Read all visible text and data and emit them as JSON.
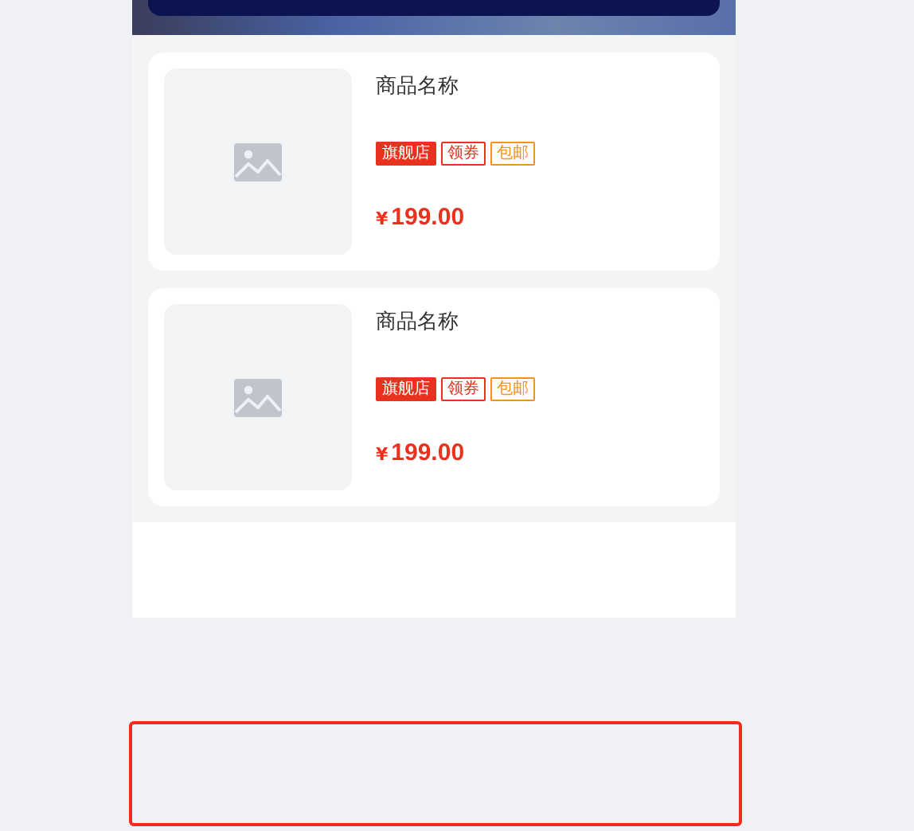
{
  "products": [
    {
      "title": "商品名称",
      "tags": [
        {
          "label": "旗舰店",
          "kind": "solid",
          "color": "#e8321f"
        },
        {
          "label": "领券",
          "kind": "outline",
          "color": "#e8321f"
        },
        {
          "label": "包邮",
          "kind": "outline",
          "color": "#f5921e"
        }
      ],
      "price": "199.00",
      "currency": "¥"
    },
    {
      "title": "商品名称",
      "tags": [
        {
          "label": "旗舰店",
          "kind": "solid",
          "color": "#e8321f"
        },
        {
          "label": "领券",
          "kind": "outline",
          "color": "#e8321f"
        },
        {
          "label": "包邮",
          "kind": "outline",
          "color": "#f5921e"
        }
      ],
      "price": "199.00",
      "currency": "¥"
    }
  ]
}
